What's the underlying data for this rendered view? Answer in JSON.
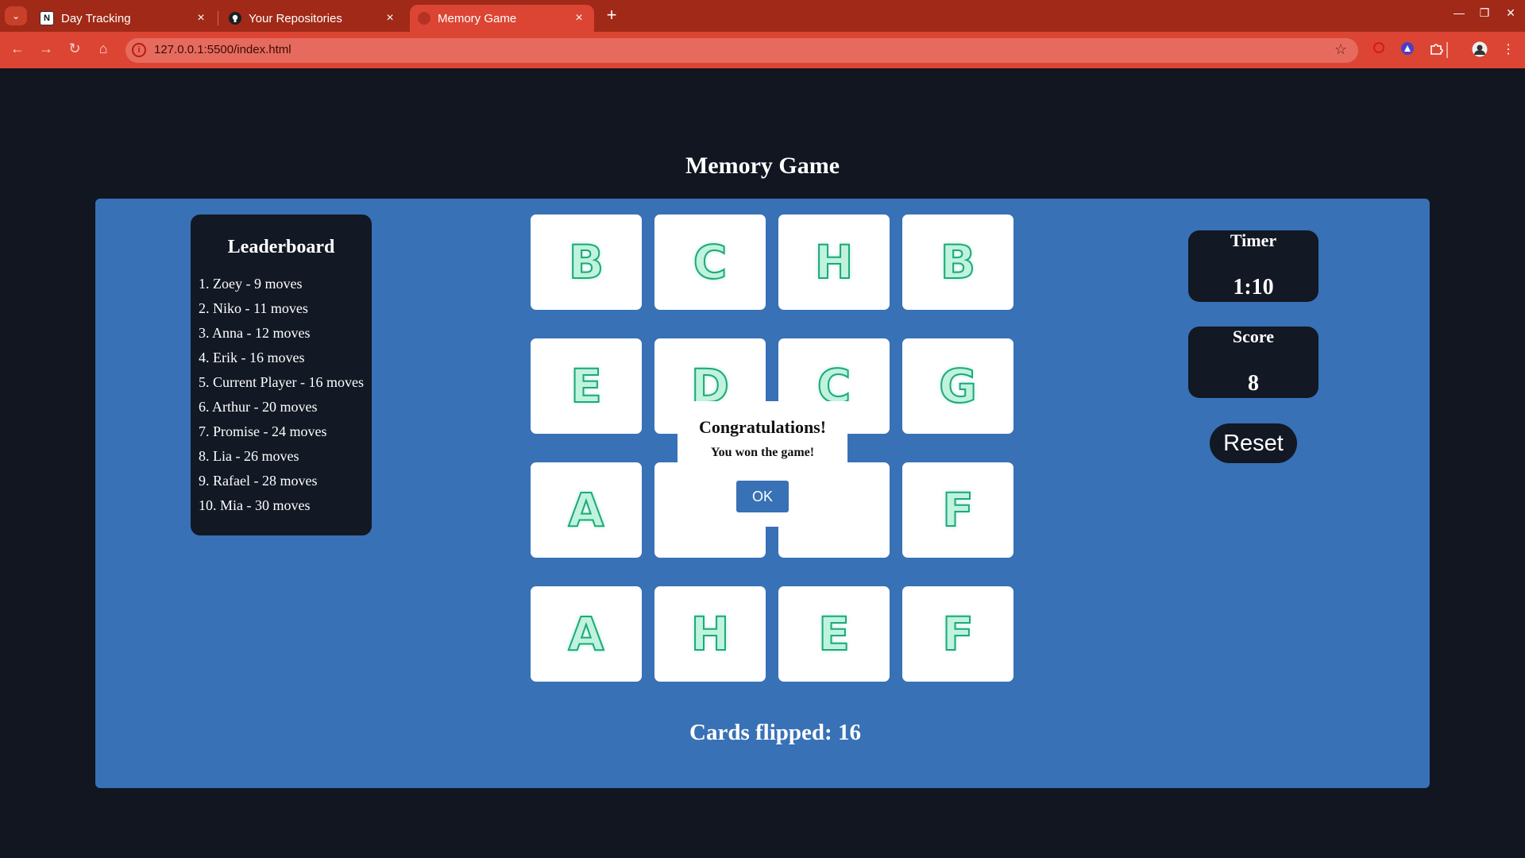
{
  "browser": {
    "tabs": [
      {
        "title": "Day Tracking",
        "favicon": "notion-icon",
        "active": false
      },
      {
        "title": "Your Repositories",
        "favicon": "github-icon",
        "active": false
      },
      {
        "title": "Memory Game",
        "favicon": "globe-icon",
        "active": true
      }
    ],
    "url": "127.0.0.1:5500/index.html",
    "colors": {
      "tab_strip": "#a12917",
      "toolbar": "#dc4534"
    }
  },
  "page": {
    "title": "Memory Game",
    "colors": {
      "background": "#111621",
      "panel": "#3871b6",
      "box": "#121824"
    }
  },
  "leaderboard": {
    "title": "Leaderboard",
    "entries": [
      "1. Zoey - 9 moves",
      "2. Niko - 11 moves",
      "3. Anna - 12 moves",
      "4. Erik - 16 moves",
      "5. Current Player - 16 moves",
      "6. Arthur - 20 moves",
      "7. Promise - 24 moves",
      "8. Lia - 26 moves",
      "9. Rafael - 28 moves",
      "10. Mia - 30 moves"
    ]
  },
  "board": {
    "cards": [
      "B",
      "C",
      "H",
      "B",
      "E",
      "D",
      "C",
      "G",
      "A",
      "",
      "",
      "F",
      "A",
      "H",
      "E",
      "F"
    ]
  },
  "timer": {
    "label": "Timer",
    "value": "1:10"
  },
  "score": {
    "label": "Score",
    "value": "8"
  },
  "reset_label": "Reset",
  "cards_flipped": "Cards flipped: 16",
  "modal": {
    "title": "Congratulations!",
    "message": "You won the game!",
    "ok_label": "OK"
  }
}
